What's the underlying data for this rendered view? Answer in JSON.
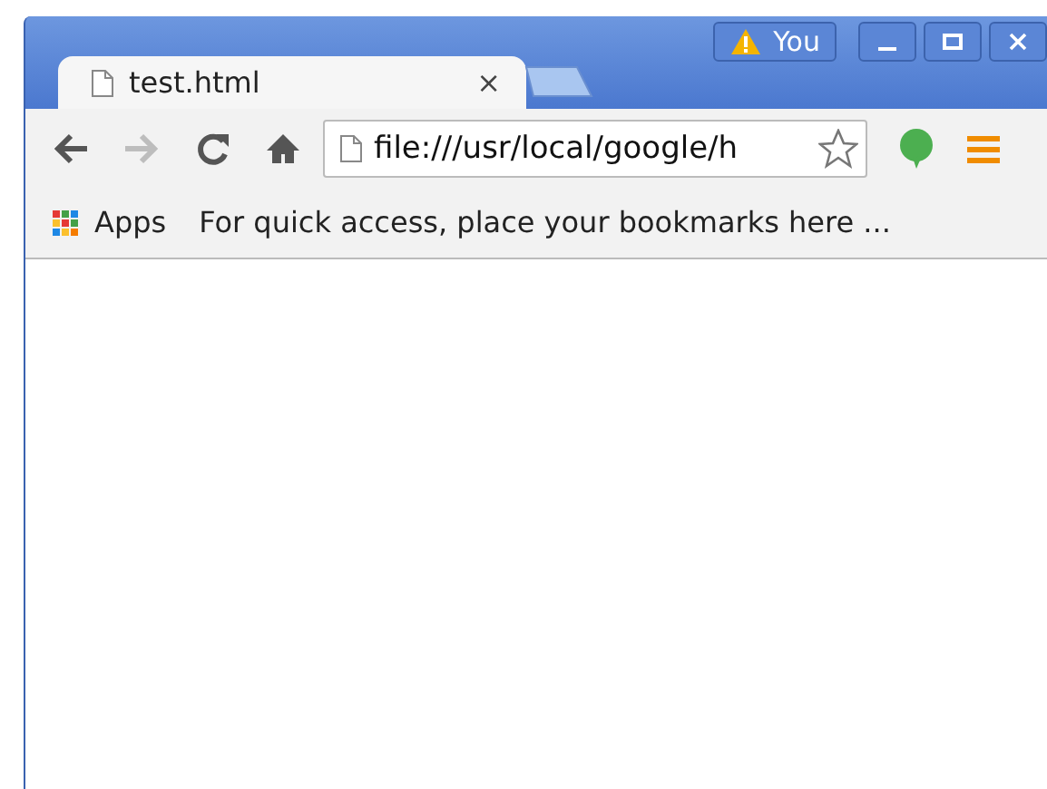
{
  "profile": {
    "label": "You"
  },
  "tabs": [
    {
      "title": "test.html",
      "close": "×",
      "selected": true
    }
  ],
  "nav_buttons": [
    {
      "kind": "back",
      "disabled": false
    },
    {
      "kind": "forward",
      "disabled": true
    },
    {
      "kind": "reload",
      "disabled": false
    },
    {
      "kind": "home",
      "disabled": false
    }
  ],
  "address_bar": {
    "value": "file:///usr/local/google/h"
  },
  "bookmarks_bar": {
    "apps_label": "Apps",
    "hint": "For quick access, place your bookmarks here ..."
  }
}
